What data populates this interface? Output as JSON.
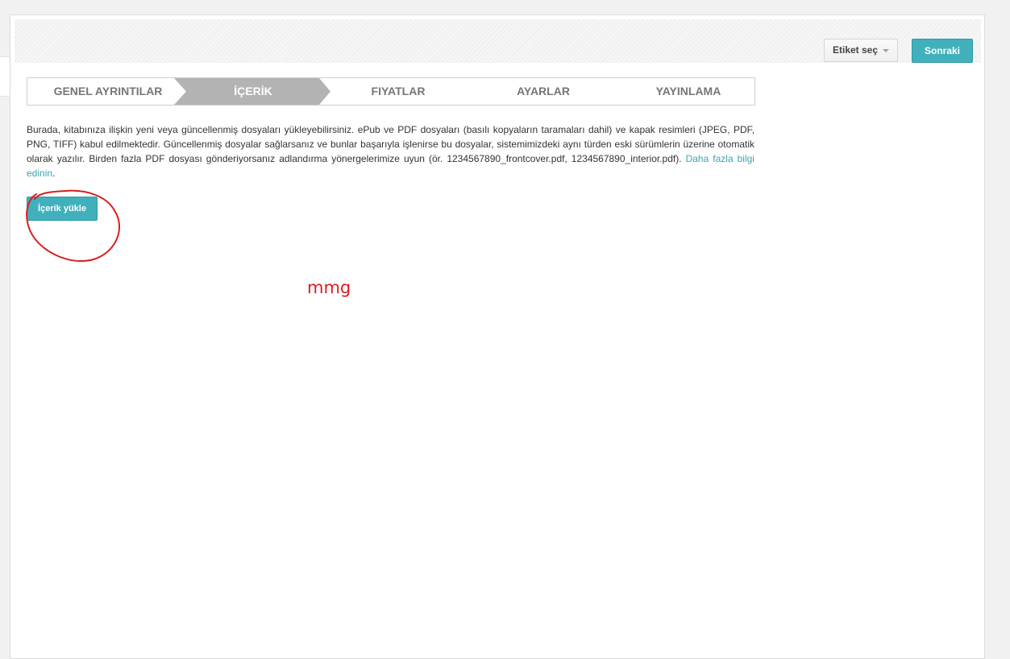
{
  "toolbar": {
    "label_select": "Etiket seç",
    "next_button": "Sonraki"
  },
  "steps": [
    {
      "label": "GENEL AYRINTILAR",
      "active": false
    },
    {
      "label": "İÇERİK",
      "active": true
    },
    {
      "label": "FIYATLAR",
      "active": false
    },
    {
      "label": "AYARLAR",
      "active": false
    },
    {
      "label": "YAYINLAMA",
      "active": false
    }
  ],
  "description": {
    "text": "Burada, kitabınıza ilişkin yeni veya güncellenmiş dosyaları yükleyebilirsiniz. ePub ve PDF dosyaları (basılı kopyaların taramaları dahil) ve kapak resimleri (JPEG, PDF, PNG, TIFF) kabul edilmektedir. Güncellenmiş dosyalar sağlarsanız ve bunlar başarıyla işlenirse bu dosyalar, sistemimizdeki aynı türden eski sürümlerin üzerine otomatik olarak yazılır. Birden fazla PDF dosyası gönderiyorsanız adlandırma yönergelerimize uyun (ör. 1234567890_frontcover.pdf, 1234567890_interior.pdf). ",
    "link": "Daha fazla bilgi edinin",
    "end": "."
  },
  "upload_button": "İçerik yükle",
  "annotation_text": "mmg",
  "colors": {
    "accent": "#41b0bd",
    "link": "#3aa5b3",
    "annotation": "#d81e1e",
    "active_step": "#b3b3b3"
  }
}
